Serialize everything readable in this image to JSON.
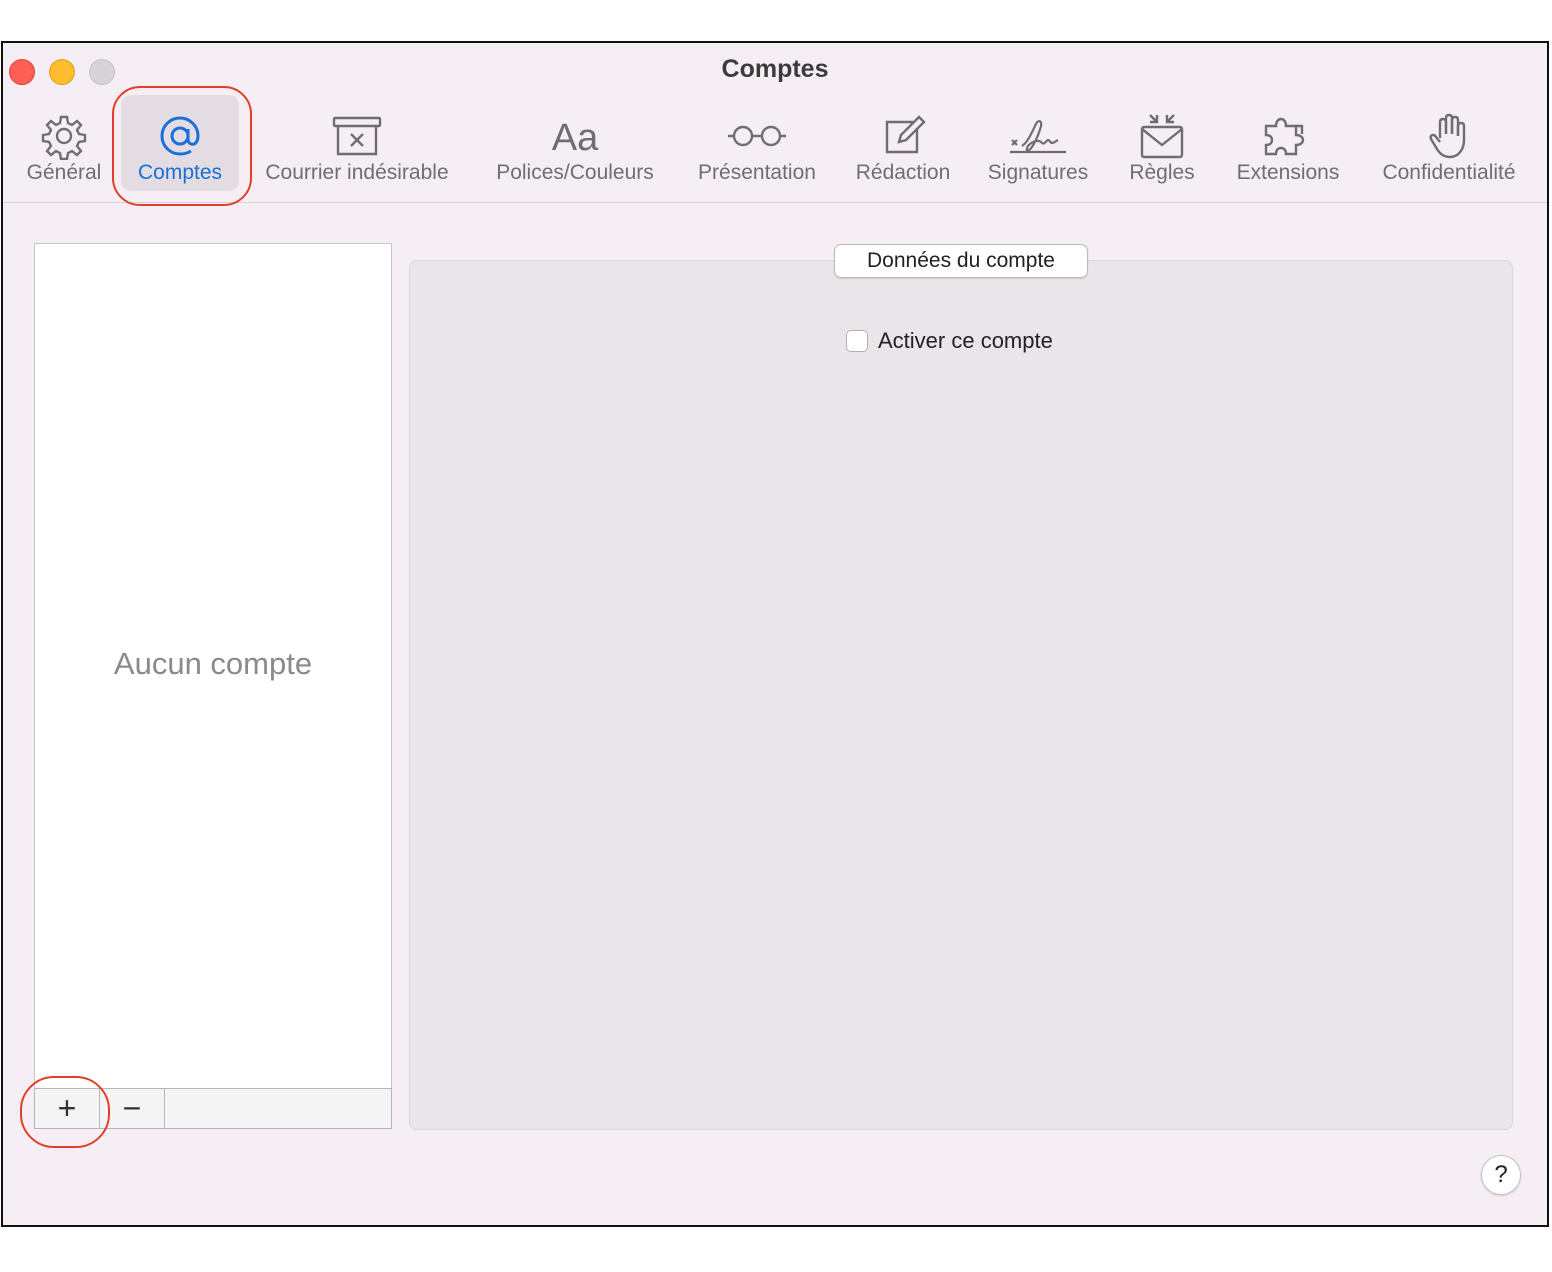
{
  "window": {
    "title": "Comptes"
  },
  "toolbar": {
    "items": [
      {
        "label": "Général",
        "icon": "gear-icon"
      },
      {
        "label": "Comptes",
        "icon": "at-sign-icon",
        "selected": true
      },
      {
        "label": "Courrier indésirable",
        "icon": "junk-box-icon"
      },
      {
        "label": "Polices/Couleurs",
        "icon": "fonts-aa-icon"
      },
      {
        "label": "Présentation",
        "icon": "glasses-icon"
      },
      {
        "label": "Rédaction",
        "icon": "compose-icon"
      },
      {
        "label": "Signatures",
        "icon": "signature-icon"
      },
      {
        "label": "Règles",
        "icon": "rules-envelope-icon"
      },
      {
        "label": "Extensions",
        "icon": "puzzle-icon"
      },
      {
        "label": "Confidentialité",
        "icon": "hand-icon"
      }
    ]
  },
  "accounts": {
    "empty_text": "Aucun compte",
    "add_label": "+",
    "remove_label": "−"
  },
  "details": {
    "tab_label": "Données du compte",
    "enable_label": "Activer ce compte",
    "enable_checked": false
  },
  "help": {
    "label": "?"
  },
  "colors": {
    "accent": "#1a6fd8",
    "annotation": "#e0402a",
    "window_bg": "#f5eff5",
    "panel_bg": "#e9e5e9"
  }
}
